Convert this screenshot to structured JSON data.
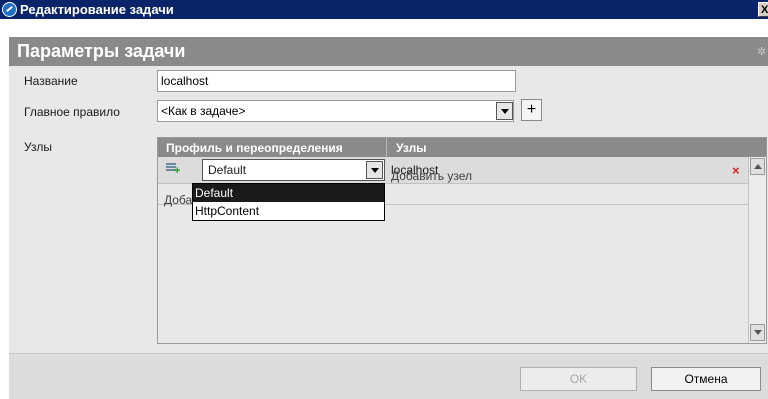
{
  "window": {
    "title": "Редактирование задачи",
    "close_label": "X"
  },
  "header": {
    "title": "Параметры задачи"
  },
  "form": {
    "name_label": "Название",
    "name_value": "localhost",
    "rule_label": "Главное правило",
    "rule_value": "<Как в задаче>",
    "add_rule_label": "+",
    "nodes_label": "Узлы"
  },
  "grid": {
    "columns": [
      "Профиль и переопределения",
      "Узлы"
    ],
    "row": {
      "profile": "Default",
      "node": "localhost"
    },
    "add_node_label": "Добавить узел",
    "add_profile_label": "Добав",
    "delete_symbol": "×"
  },
  "dropdown": {
    "options": [
      "Default",
      "HttpContent"
    ],
    "selected_index": 0
  },
  "footer": {
    "ok_label": "OK",
    "cancel_label": "Отмена"
  }
}
